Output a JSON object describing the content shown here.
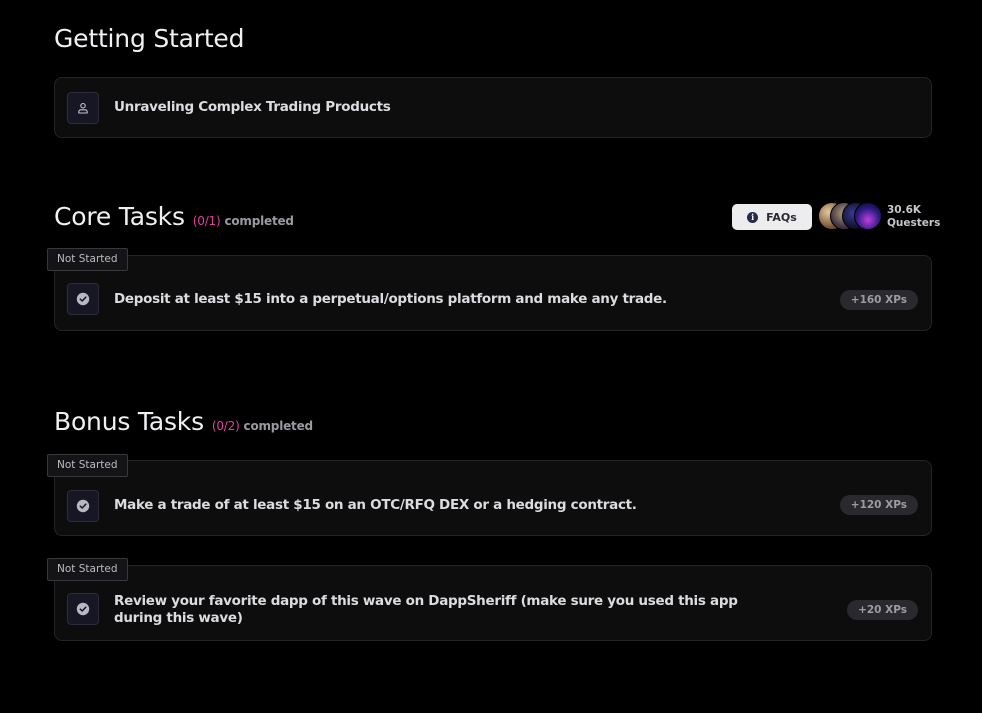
{
  "getting_started": {
    "title": "Getting Started",
    "item": {
      "label": "Unraveling Complex Trading Products",
      "icon": "user-icon"
    }
  },
  "core_tasks": {
    "title": "Core Tasks",
    "progress_count": "(0/1)",
    "progress_label": "completed",
    "faq_label": "FAQs",
    "questers_count": "30.6K",
    "questers_label": "Questers",
    "tasks": [
      {
        "status": "Not Started",
        "label": "Deposit at least $15 into a perpetual/options platform and make any trade.",
        "xp": "+160 XPs",
        "icon": "check-circle-icon"
      }
    ]
  },
  "bonus_tasks": {
    "title": "Bonus Tasks",
    "progress_count": "(0/2)",
    "progress_label": "completed",
    "tasks": [
      {
        "status": "Not Started",
        "label": "Make a trade of at least $15 on an OTC/RFQ DEX or a hedging contract.",
        "xp": "+120 XPs",
        "icon": "check-circle-icon"
      },
      {
        "status": "Not Started",
        "label_line1": "Review your favorite dapp of this wave on DappSheriff (make sure you used this app",
        "label_line2": "during this wave)",
        "xp": "+20 XPs",
        "icon": "check-circle-icon"
      }
    ]
  },
  "colors": {
    "accent": "#e0409a",
    "background": "#000000",
    "card": "#0d0d0e"
  }
}
